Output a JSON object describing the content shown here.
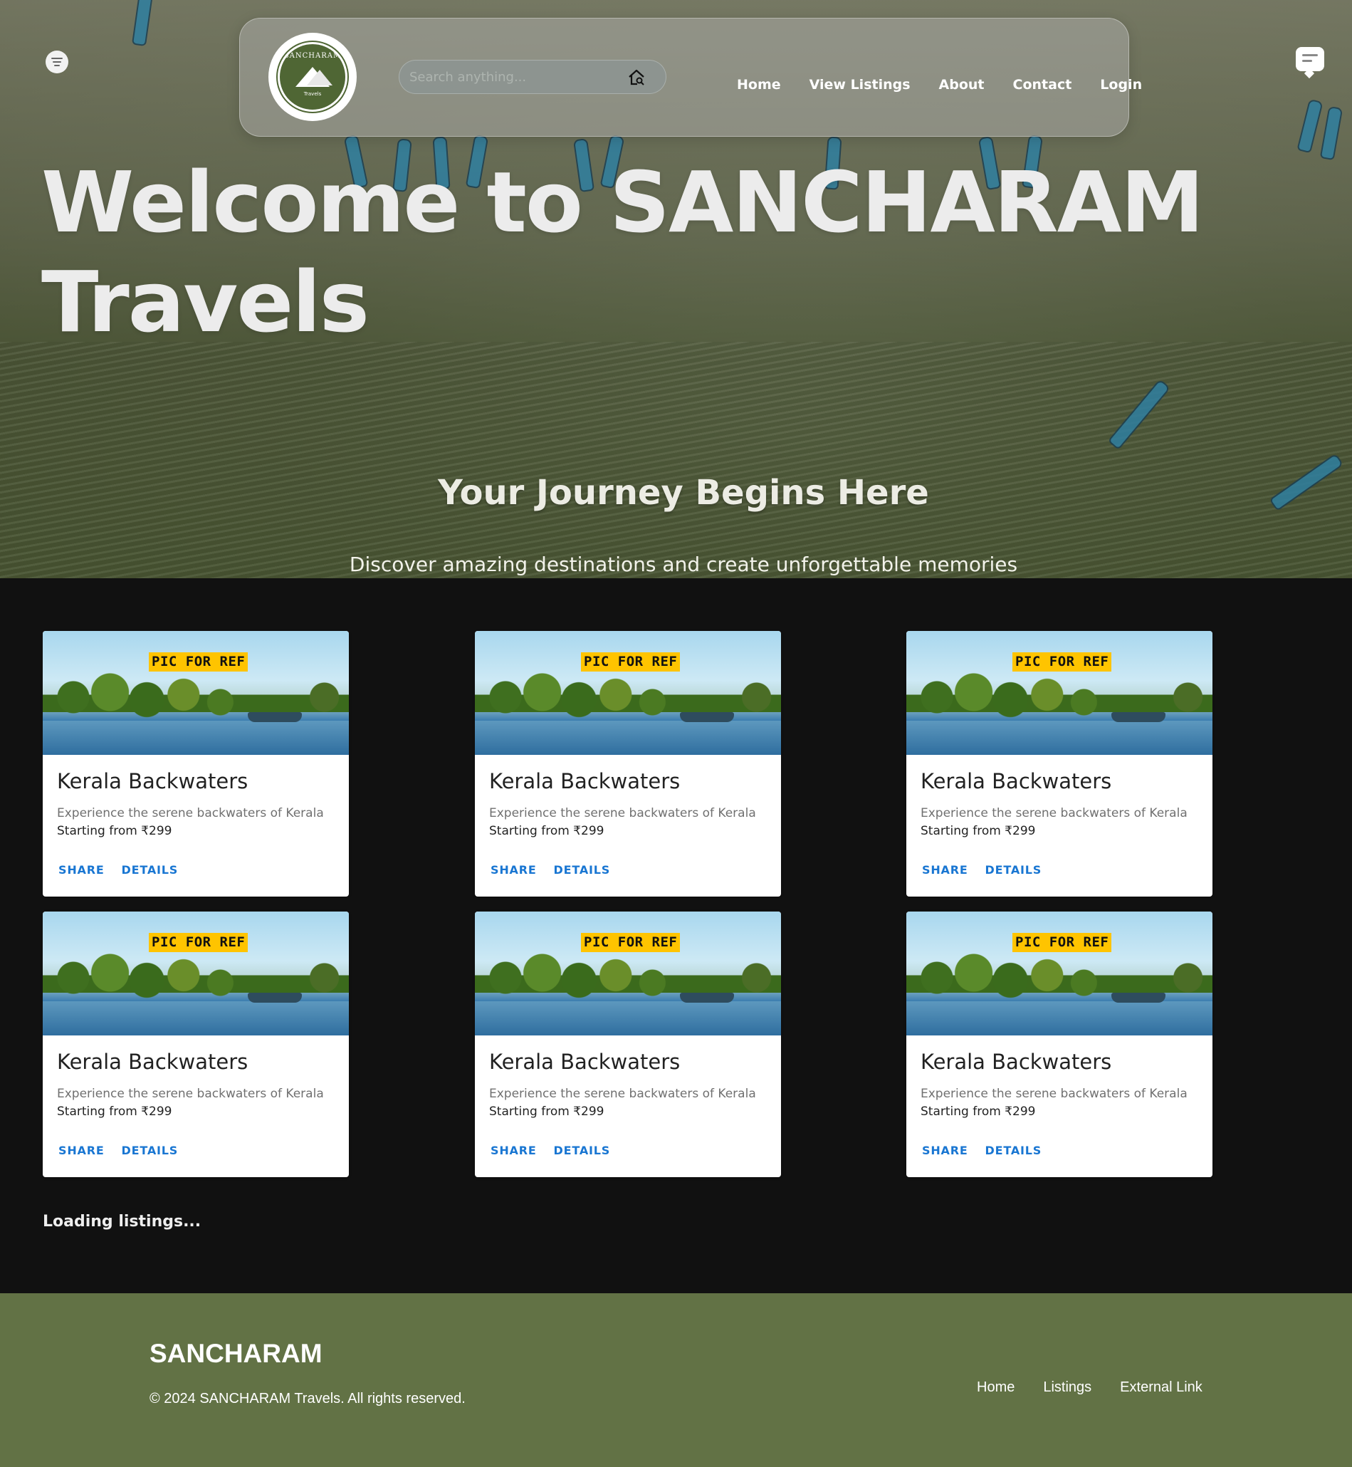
{
  "nav": {
    "logo_top_text": "SANCHARAM",
    "logo_bottom_text": "Travels",
    "search_placeholder": "Search anything...",
    "links": [
      "Home",
      "View Listings",
      "About",
      "Contact",
      "Login"
    ]
  },
  "hero": {
    "title_line1": "Welcome to SANCHARAM",
    "title_line2": "Travels",
    "subtitle": "Your Journey Begins Here",
    "description": "Discover amazing destinations and create unforgettable memories"
  },
  "icons": {
    "top_left": "menu-icon",
    "top_right": "chat-icon",
    "search": "home-search-icon"
  },
  "cards": [
    {
      "badge": "PIC FOR REF",
      "title": "Kerala Backwaters",
      "description": "Experience the serene backwaters of Kerala",
      "price": "Starting from ₹299",
      "share": "SHARE",
      "details": "DETAILS"
    },
    {
      "badge": "PIC FOR REF",
      "title": "Kerala Backwaters",
      "description": "Experience the serene backwaters of Kerala",
      "price": "Starting from ₹299",
      "share": "SHARE",
      "details": "DETAILS"
    },
    {
      "badge": "PIC FOR REF",
      "title": "Kerala Backwaters",
      "description": "Experience the serene backwaters of Kerala",
      "price": "Starting from ₹299",
      "share": "SHARE",
      "details": "DETAILS"
    },
    {
      "badge": "PIC FOR REF",
      "title": "Kerala Backwaters",
      "description": "Experience the serene backwaters of Kerala",
      "price": "Starting from ₹299",
      "share": "SHARE",
      "details": "DETAILS"
    },
    {
      "badge": "PIC FOR REF",
      "title": "Kerala Backwaters",
      "description": "Experience the serene backwaters of Kerala",
      "price": "Starting from ₹299",
      "share": "SHARE",
      "details": "DETAILS"
    },
    {
      "badge": "PIC FOR REF",
      "title": "Kerala Backwaters",
      "description": "Experience the serene backwaters of Kerala",
      "price": "Starting from ₹299",
      "share": "SHARE",
      "details": "DETAILS"
    }
  ],
  "loading_text": "Loading listings...",
  "footer": {
    "brand": "SANCHARAM",
    "copyright": "© 2024 SANCHARAM Travels. All rights reserved.",
    "links": [
      "Home",
      "Listings",
      "External Link"
    ]
  },
  "colors": {
    "page_background": "#111111",
    "footer_background": "#627245",
    "accent_link": "#1976d2",
    "badge": "#ffc400"
  }
}
